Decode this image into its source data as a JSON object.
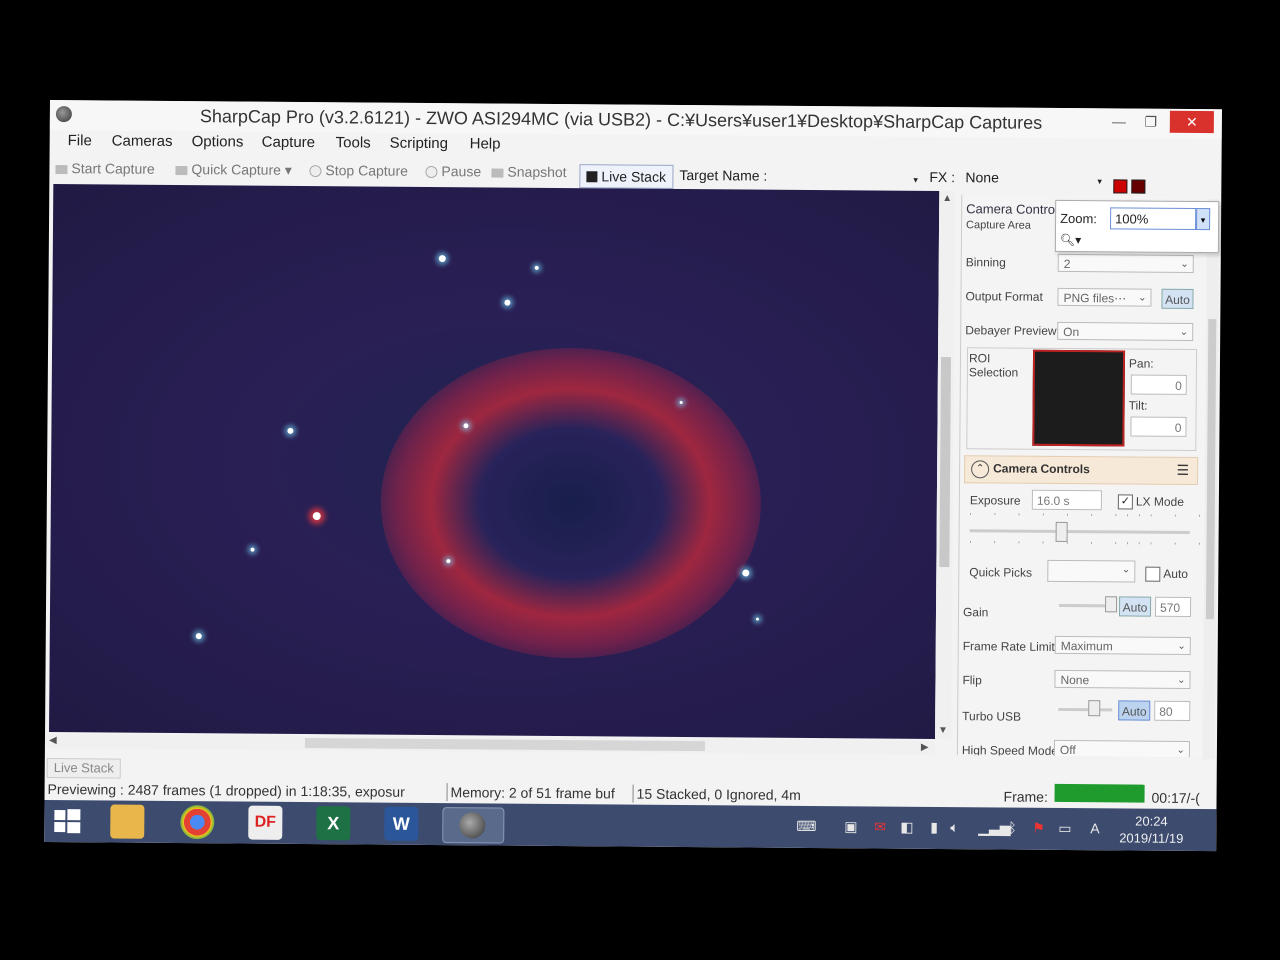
{
  "window": {
    "title": "SharpCap Pro (v3.2.6121) - ZWO ASI294MC (via USB2) - C:¥Users¥user1¥Desktop¥SharpCap Captures",
    "min": "—",
    "max": "❐",
    "close": "✕"
  },
  "menu": [
    "File",
    "Cameras",
    "Options",
    "Capture",
    "Tools",
    "Scripting",
    "Help"
  ],
  "toolbar": {
    "start_capture": "Start Capture",
    "quick_capture": "Quick Capture",
    "stop_capture": "Stop Capture",
    "pause": "Pause",
    "snapshot": "Snapshot",
    "live_stack": "Live Stack",
    "target_name": "Target Name :",
    "fx_label": "FX :",
    "fx_value": "None"
  },
  "zoom": {
    "label": "Zoom:",
    "value": "100%"
  },
  "panel": {
    "tab": "Camera Contro",
    "capture_area": "Capture Area",
    "binning_label": "Binning",
    "binning_value": "2",
    "output_format_label": "Output Format",
    "output_format_value": "PNG files⋯",
    "output_auto": "Auto",
    "debayer_label": "Debayer Preview",
    "debayer_value": "On",
    "roi_label": "ROI\nSelection",
    "pan_label": "Pan:",
    "pan_value": "0",
    "tilt_label": "Tilt:",
    "tilt_value": "0",
    "section_title": "Camera Controls",
    "exposure_label": "Exposure",
    "exposure_value": "16.0 s",
    "lx_mode_label": "LX Mode",
    "lx_mode_checked": true,
    "quick_picks_label": "Quick Picks",
    "quick_picks_auto": "Auto",
    "gain_label": "Gain",
    "gain_auto": "Auto",
    "gain_value": "570",
    "frame_rate_label": "Frame Rate Limit",
    "frame_rate_value": "Maximum",
    "flip_label": "Flip",
    "flip_value": "None",
    "turbo_label": "Turbo USB",
    "turbo_auto": "Auto",
    "turbo_value": "80",
    "high_speed_label": "High Speed Mode",
    "high_speed_value": "Off"
  },
  "bottom": {
    "tab": "Live Stack",
    "status_preview": "Previewing : 2487 frames (1 dropped) in 1:18:35, exposur",
    "status_memory": "Memory: 2 of 51 frame buf",
    "status_stack": "15 Stacked, 0 Ignored, 4m",
    "frame_label": "Frame:",
    "frame_time": "00:17/-("
  },
  "taskbar": {
    "time": "20:24",
    "date": "2019/11/19",
    "ime": "A"
  },
  "colors": {
    "accent": "#d9312b",
    "taskbar": "#3c4b6e",
    "progress": "#1e9b2c"
  }
}
